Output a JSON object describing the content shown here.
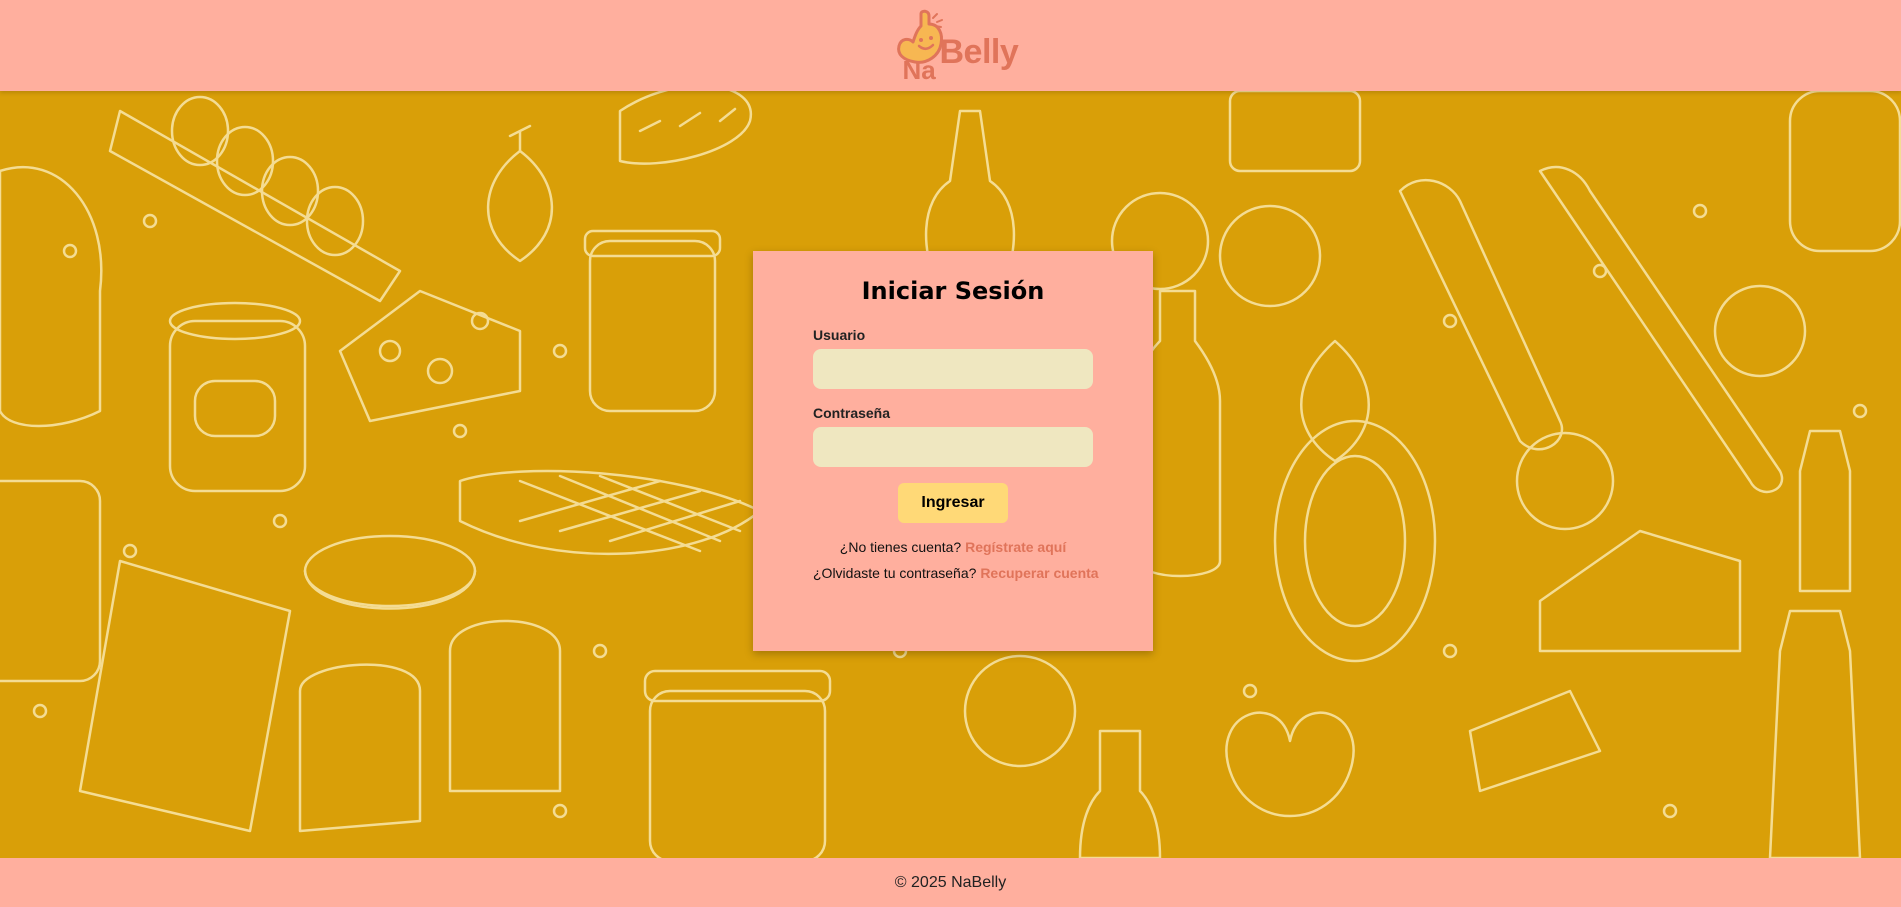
{
  "header": {
    "logo": {
      "name_part1": "Na",
      "name_part2": "Belly",
      "icon": "smiling-stomach-logo"
    }
  },
  "background": {
    "pattern": "hand-drawn-grocery-doodles",
    "color": "#d99f08",
    "line_color": "#f7e3a3"
  },
  "login": {
    "title": "Iniciar Sesión",
    "username_label": "Usuario",
    "username_value": "",
    "password_label": "Contraseña",
    "password_value": "",
    "submit_label": "Ingresar",
    "register_prompt": "¿No tienes cuenta?",
    "register_link": "Regístrate aquí",
    "recover_prompt": "¿Olvidaste tu contraseña?",
    "recover_link": "Recuperar cuenta"
  },
  "footer": {
    "copyright": "© 2025 NaBelly"
  },
  "colors": {
    "header_bg": "#ffaf9e",
    "accent": "#e0745a",
    "button": "#ffd977",
    "input_bg": "#efe7c0"
  }
}
